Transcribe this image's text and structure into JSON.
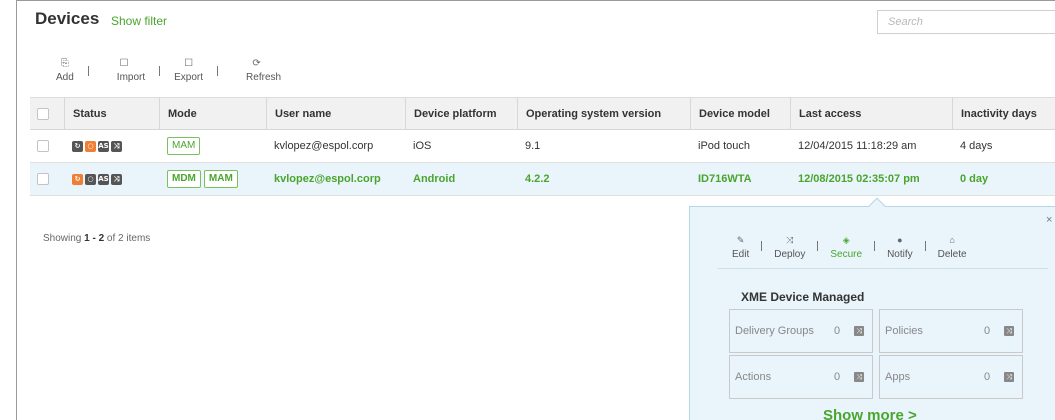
{
  "header": {
    "title": "Devices",
    "show_filter": "Show filter",
    "search_placeholder": "Search"
  },
  "toolbar": {
    "add": "Add",
    "import": "Import",
    "export": "Export",
    "refresh": "Refresh"
  },
  "table": {
    "columns": [
      "Status",
      "Mode",
      "User name",
      "Device platform",
      "Operating system version",
      "Device model",
      "Last access",
      "Inactivity days"
    ],
    "rows": [
      {
        "modes": [
          "MAM"
        ],
        "user": "kvlopez@espol.corp",
        "platform": "iOS",
        "os": "9.1",
        "model": "iPod touch",
        "last_access": "12/04/2015 11:18:29 am",
        "inactivity": "4 days"
      },
      {
        "modes": [
          "MDM",
          "MAM"
        ],
        "user": "kvlopez@espol.corp",
        "platform": "Android",
        "os": "4.2.2",
        "model": "ID716WTA",
        "last_access": "12/08/2015 02:35:07 pm",
        "inactivity": "0 day"
      }
    ]
  },
  "pagination": {
    "prefix": "Showing ",
    "range": "1 - 2",
    "suffix": " of 2 items"
  },
  "panel": {
    "close": "×",
    "actions": {
      "edit": "Edit",
      "deploy": "Deploy",
      "secure": "Secure",
      "notify": "Notify",
      "delete": "Delete"
    },
    "title": "XME Device Managed",
    "boxes": {
      "delivery_groups": {
        "label": "Delivery Groups",
        "count": "0"
      },
      "policies": {
        "label": "Policies",
        "count": "0"
      },
      "actions": {
        "label": "Actions",
        "count": "0"
      },
      "apps": {
        "label": "Apps",
        "count": "0"
      }
    },
    "show_more": "Show more >"
  },
  "colors": {
    "accent": "#4aa52e",
    "selected_row": "#e9f4fb",
    "warning": "#f07f36"
  }
}
